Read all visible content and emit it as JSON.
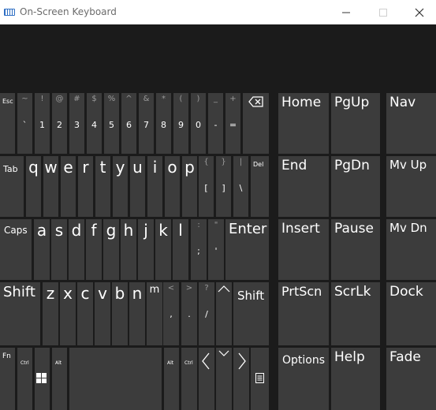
{
  "window": {
    "title": "On-Screen Keyboard",
    "controls": {
      "minimize": "—",
      "maximize": "☐",
      "close": "✕"
    }
  },
  "row1": {
    "esc": "Esc",
    "keys": [
      {
        "top": "~",
        "bottom": "`"
      },
      {
        "top": "!",
        "bottom": "1"
      },
      {
        "top": "@",
        "bottom": "2"
      },
      {
        "top": "#",
        "bottom": "3"
      },
      {
        "top": "$",
        "bottom": "4"
      },
      {
        "top": "%",
        "bottom": "5"
      },
      {
        "top": "^",
        "bottom": "6"
      },
      {
        "top": "&",
        "bottom": "7"
      },
      {
        "top": "*",
        "bottom": "8"
      },
      {
        "top": "(",
        "bottom": "9"
      },
      {
        "top": ")",
        "bottom": "0"
      },
      {
        "top": "_",
        "bottom": "-"
      },
      {
        "top": "+",
        "bottom": "="
      }
    ],
    "backspace": "⌫"
  },
  "row2": {
    "tab": "Tab",
    "letters": [
      "q",
      "w",
      "e",
      "r",
      "t",
      "y",
      "u",
      "i",
      "o",
      "p"
    ],
    "bracket_open": {
      "top": "{",
      "bottom": "["
    },
    "bracket_close": {
      "top": "}",
      "bottom": "]"
    },
    "pipe": {
      "top": "|",
      "bottom": "\\"
    },
    "del": "Del"
  },
  "row3": {
    "caps": "Caps",
    "letters": [
      "a",
      "s",
      "d",
      "f",
      "g",
      "h",
      "j",
      "k",
      "l"
    ],
    "semicolon": {
      "top": ":",
      "bottom": ";"
    },
    "quote": {
      "top": "\"",
      "bottom": "'"
    },
    "enter": "Enter"
  },
  "row4": {
    "shift_left": "Shift",
    "letters": [
      "z",
      "x",
      "c",
      "v",
      "b",
      "n",
      "m"
    ],
    "comma": {
      "top": "<",
      "bottom": ","
    },
    "period": {
      "top": ">",
      "bottom": "."
    },
    "slash": {
      "top": "?",
      "bottom": "/"
    },
    "up": "⌃",
    "shift_right": "Shift"
  },
  "row5": {
    "fn": "Fn",
    "ctrl_left": "Ctrl",
    "alt_left": "Alt",
    "alt_right": "Alt",
    "ctrl_right": "Ctrl",
    "left": "〈",
    "down": "⌄",
    "right": "〉"
  },
  "nav": {
    "home": "Home",
    "pgup": "PgUp",
    "nav": "Nav",
    "end": "End",
    "pgdn": "PgDn",
    "mvup": "Mv Up",
    "insert": "Insert",
    "pause": "Pause",
    "mvdn": "Mv Dn",
    "prtscn": "PrtScn",
    "scrlk": "ScrLk",
    "dock": "Dock",
    "options": "Options",
    "help": "Help",
    "fade": "Fade"
  }
}
